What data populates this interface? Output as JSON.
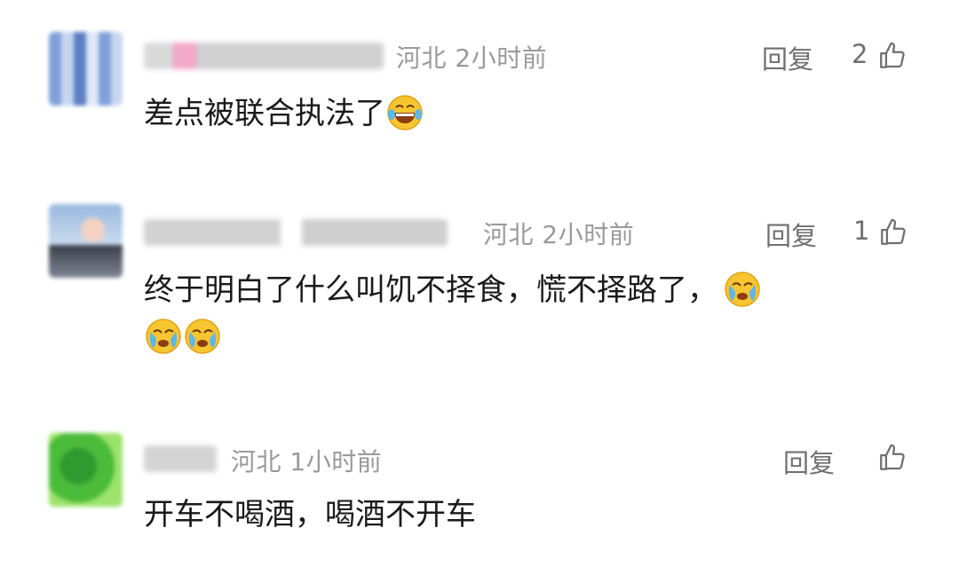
{
  "comments": [
    {
      "location": "河北",
      "time": "2小时前",
      "reply_label": "回复",
      "likes": "2",
      "text": "差点被联合执法了",
      "emojis": [
        "laughing-tears-emoji"
      ]
    },
    {
      "location": "河北",
      "time": "2小时前",
      "reply_label": "回复",
      "likes": "1",
      "text_line1": "终于明白了什么叫饥不择食，慌不择路了，",
      "emojis": [
        "crying-emoji",
        "crying-emoji",
        "crying-emoji"
      ]
    },
    {
      "location": "河北",
      "time": "1小时前",
      "reply_label": "回复",
      "likes": "",
      "text": "开车不喝酒，喝酒不开车"
    }
  ],
  "icons": {
    "like": "thumbs-up-outline-icon"
  },
  "colors": {
    "meta": "#9a9a9a",
    "text": "#1a1a1a",
    "action": "#6f6f6f"
  }
}
